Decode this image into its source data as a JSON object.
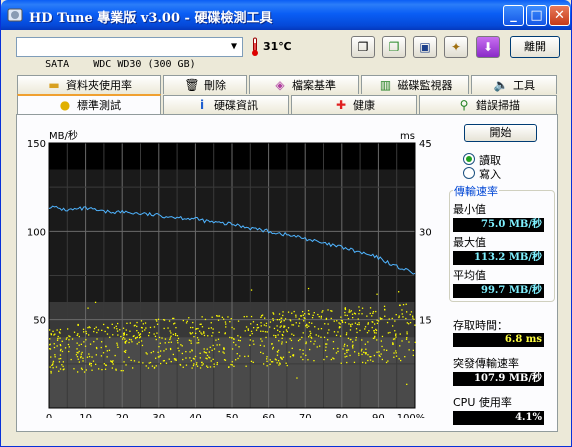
{
  "window": {
    "title": "HD Tune 專業版 v3.00 - 硬碟檢測工具"
  },
  "titlebar_buttons": {
    "minimize": "_",
    "maximize": "□",
    "close": "✕"
  },
  "toolbar": {
    "drive": "SATA    WDC WD30 (300 GB)",
    "temperature": "31℃",
    "buttons": [
      "copy-text-icon",
      "copy-image-icon",
      "save-icon",
      "settings-icon",
      "options-icon"
    ],
    "exit_label": "離開"
  },
  "tabs_row1": [
    {
      "label": "資料夾使用率",
      "icon": "folder-icon"
    },
    {
      "label": "刪除",
      "icon": "trash-icon"
    },
    {
      "label": "檔案基準",
      "icon": "file-bench-icon"
    },
    {
      "label": "磁碟監視器",
      "icon": "monitor-icon"
    },
    {
      "label": "工具",
      "icon": "speaker-icon"
    }
  ],
  "tabs_row2": [
    {
      "label": "標準測試",
      "icon": "bulb-icon",
      "active": true
    },
    {
      "label": "硬碟資訊",
      "icon": "info-icon"
    },
    {
      "label": "健康",
      "icon": "health-cross-icon"
    },
    {
      "label": "錯誤掃描",
      "icon": "magnifier-icon"
    }
  ],
  "side": {
    "start_label": "開始",
    "read_label": "讀取",
    "write_label": "寫入",
    "transfer_rate_label": "傳輸速率",
    "min_label": "最小值",
    "min_value": "75.0 MB/秒",
    "max_label": "最大值",
    "max_value": "113.2 MB/秒",
    "avg_label": "平均值",
    "avg_value": "99.7 MB/秒",
    "access_label": "存取時間：",
    "access_value": "6.8 ms",
    "burst_label": "突發傳輸速率",
    "burst_value": "107.9 MB/秒",
    "cpu_label": "CPU 使用率",
    "cpu_value": "4.1%"
  },
  "chart_data": {
    "type": "line",
    "ylabel_left": "MB/秒",
    "ylabel_right": "ms",
    "ylim_left": [
      0,
      150
    ],
    "ylim_right": [
      0,
      45
    ],
    "yticks_left": [
      "150",
      "100",
      "50"
    ],
    "yticks_right": [
      "45",
      "30",
      "15"
    ],
    "xticks": [
      "0",
      "10",
      "20",
      "30",
      "40",
      "50",
      "60",
      "70",
      "80",
      "90",
      "100%"
    ],
    "x": [
      0,
      5,
      10,
      15,
      20,
      25,
      30,
      35,
      40,
      45,
      50,
      55,
      60,
      65,
      70,
      75,
      80,
      85,
      90,
      95,
      100
    ],
    "series": [
      {
        "name": "transfer-rate",
        "axis": "left",
        "color": "#4fb4ff",
        "values": [
          114,
          112,
          113,
          111,
          111,
          110,
          109,
          108,
          107,
          105,
          104,
          102,
          100,
          98,
          96,
          93,
          91,
          88,
          85,
          80,
          76
        ]
      }
    ],
    "access_times_ms": {
      "axis": "right",
      "color": "#ffff00",
      "range_ms": [
        3,
        21
      ],
      "typical_ms": [
        6,
        14
      ],
      "count": 900
    },
    "grid": true
  }
}
